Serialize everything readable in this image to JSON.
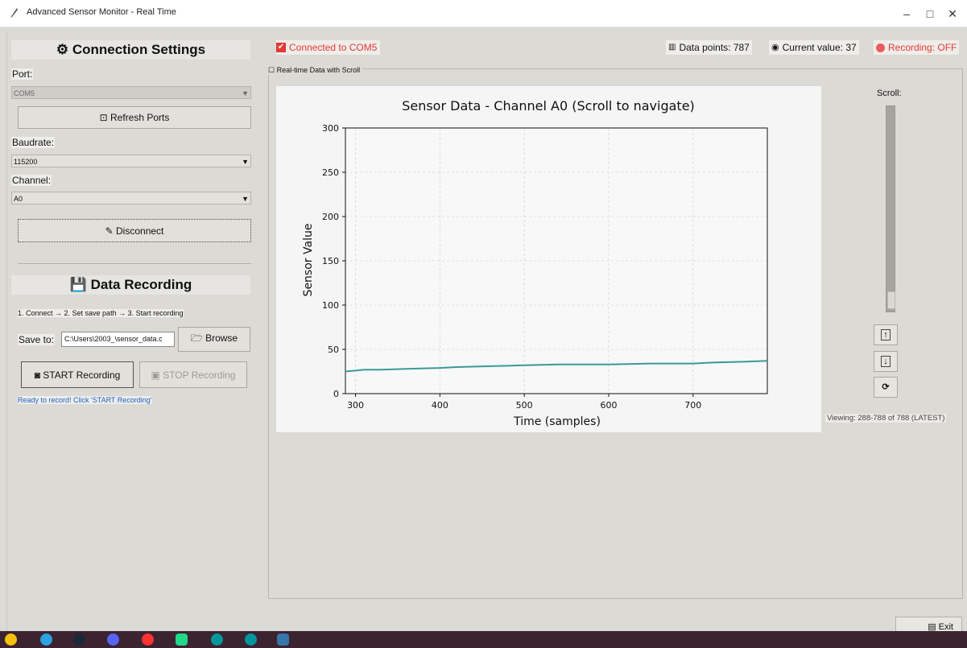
{
  "window": {
    "title": "Advanced Sensor Monitor - Real Time",
    "min_glyph": "–",
    "max_glyph": "□",
    "close_glyph": "✕"
  },
  "connection": {
    "heading": "⚙ Connection Settings",
    "port_label": "Port:",
    "port_value": "COM5",
    "refresh_label": "⊡ Refresh Ports",
    "baud_label": "Baudrate:",
    "baud_value": "115200",
    "channel_label": "Channel:",
    "channel_value": "A0",
    "disconnect_label": "✎ Disconnect"
  },
  "recording": {
    "heading": "💾 Data Recording",
    "steps": "1. Connect → 2. Set save path → 3. Start recording",
    "save_to_label": "Save to:",
    "save_path": "C:\\Users\\2003_\\sensor_data.c",
    "browse_label": "🗁 Browse",
    "start_label": "◙ START Recording",
    "stop_label": "▣ STOP Recording",
    "ready_text": "Ready to record! Click 'START Recording'"
  },
  "status": {
    "connected": "Connected to COM5",
    "data_points": "Data points: 787",
    "current_value": "Current value: 37",
    "recording": "Recording: OFF",
    "colors": {
      "connected": "#e53935",
      "recording": "#e53935"
    }
  },
  "realtime_label": "Real-time Data with Scroll",
  "scroll": {
    "label": "Scroll:",
    "position": 1.0,
    "up_glyph": "↑",
    "down_glyph": "↓",
    "refresh_glyph": "⟳",
    "viewing": "Viewing: 288-788 of 788 (LATEST)"
  },
  "exit_label": "▤ Exit",
  "chart_data": {
    "type": "line",
    "title": "Sensor Data - Channel A0 (Scroll to navigate)",
    "xlabel": "Time (samples)",
    "ylabel": "Sensor Value",
    "xlim": [
      288,
      788
    ],
    "ylim": [
      0,
      300
    ],
    "xticks": [
      300,
      400,
      500,
      600,
      700
    ],
    "yticks": [
      0,
      50,
      100,
      150,
      200,
      250,
      300
    ],
    "grid": true,
    "color": "#3a9a96",
    "x": [
      288,
      300,
      310,
      330,
      360,
      400,
      420,
      460,
      500,
      540,
      560,
      600,
      650,
      700,
      720,
      760,
      788
    ],
    "y": [
      25,
      26,
      27,
      27,
      28,
      29,
      30,
      31,
      32,
      33,
      33,
      33,
      34,
      34,
      35,
      36,
      37
    ]
  },
  "taskbar": {
    "icons": [
      "sun-icon",
      "telegram-icon",
      "steam-icon",
      "discord-icon",
      "yandex-icon",
      "pycharm-icon",
      "arduino-icon",
      "arduino-icon",
      "python-icon"
    ]
  }
}
